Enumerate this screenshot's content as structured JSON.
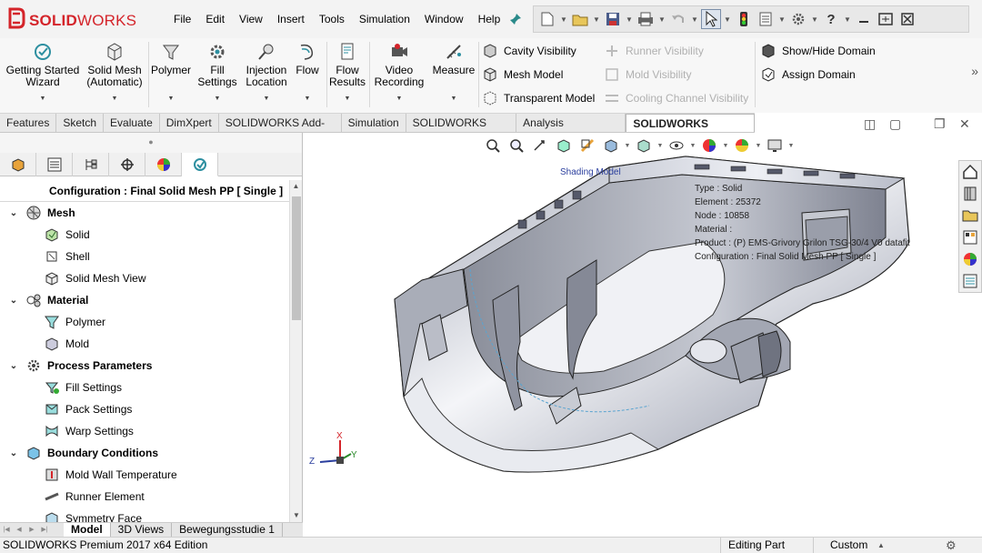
{
  "app": {
    "brand": "SOLIDWORKS",
    "brand_part1": "SOLID",
    "brand_part2": "WORKS",
    "brand_color": "#d4242a"
  },
  "menu": [
    "File",
    "Edit",
    "View",
    "Insert",
    "Tools",
    "Simulation",
    "Window",
    "Help"
  ],
  "ribbon": {
    "buttons": [
      {
        "label1": "Getting Started",
        "label2": "Wizard",
        "icon": "wizard-icon"
      },
      {
        "label1": "Solid Mesh",
        "label2": "(Automatic)",
        "icon": "mesh-cube-icon"
      },
      {
        "label1": "Polymer",
        "label2": "",
        "icon": "polymer-funnel-icon"
      },
      {
        "label1": "Fill",
        "label2": "Settings",
        "icon": "fill-settings-icon"
      },
      {
        "label1": "Injection",
        "label2": "Location",
        "icon": "injection-pin-icon"
      },
      {
        "label1": "Flow",
        "label2": "",
        "icon": "flow-icon"
      },
      {
        "label1": "Flow",
        "label2": "Results",
        "icon": "results-doc-icon"
      },
      {
        "label1": "Video",
        "label2": "Recording",
        "icon": "video-icon"
      },
      {
        "label1": "Measure",
        "label2": "",
        "icon": "measure-icon"
      }
    ],
    "col1": [
      "Cavity Visibility",
      "Mesh Model",
      "Transparent Model"
    ],
    "col2": [
      "Runner Visibility",
      "Mold Visibility",
      "Cooling Channel Visibility"
    ],
    "col3": [
      "Show/Hide Domain",
      "Assign Domain"
    ]
  },
  "tabs": [
    "Features",
    "Sketch",
    "Evaluate",
    "DimXpert",
    "SOLIDWORKS Add-Ins",
    "Simulation",
    "SOLIDWORKS MBD",
    "Analysis Preparation",
    "SOLIDWORKS Plastics"
  ],
  "active_tab": "SOLIDWORKS Plastics",
  "tree": {
    "config": "Configuration : Final Solid Mesh PP [ Single ]",
    "nodes": [
      {
        "type": "grp",
        "label": "Mesh",
        "icon": "mesh-icon"
      },
      {
        "type": "leaf",
        "label": "Solid",
        "icon": "solid-icon"
      },
      {
        "type": "leaf",
        "label": "Shell",
        "icon": "shell-icon"
      },
      {
        "type": "leaf",
        "label": "Solid Mesh View",
        "icon": "mesh-view-icon"
      },
      {
        "type": "grp",
        "label": "Material",
        "icon": "material-icon"
      },
      {
        "type": "leaf",
        "label": "Polymer",
        "icon": "polymer-icon"
      },
      {
        "type": "leaf",
        "label": "Mold",
        "icon": "mold-icon"
      },
      {
        "type": "grp",
        "label": "Process Parameters",
        "icon": "gear-icon"
      },
      {
        "type": "leaf",
        "label": "Fill Settings",
        "icon": "fill-icon"
      },
      {
        "type": "leaf",
        "label": "Pack Settings",
        "icon": "pack-icon"
      },
      {
        "type": "leaf",
        "label": "Warp Settings",
        "icon": "warp-icon"
      },
      {
        "type": "grp",
        "label": "Boundary Conditions",
        "icon": "boundary-icon"
      },
      {
        "type": "leaf",
        "label": "Mold Wall Temperature",
        "icon": "wall-temp-icon"
      },
      {
        "type": "leaf",
        "label": "Runner Element",
        "icon": "runner-icon"
      },
      {
        "type": "leaf",
        "label": "Symmetry Face",
        "icon": "symmetry-icon"
      }
    ]
  },
  "bottom_tabs": [
    "Model",
    "3D Views",
    "Bewegungsstudie 1"
  ],
  "status": {
    "left": "SOLIDWORKS Premium 2017 x64 Edition",
    "mode": "Editing Part",
    "units": "Custom"
  },
  "viewport": {
    "shading_label": "Shading Model",
    "info": [
      "Type : Solid",
      "Element : 25372",
      "Node : 10858",
      "Material :",
      "Product :     (P) EMS-Grivory Grilon TSG-30/4  V0 datafit",
      "Configuration : Final Solid Mesh PP [ Single ]"
    ],
    "triad": {
      "x": "X",
      "y": "Y",
      "z": "Z"
    }
  },
  "colors": {
    "accent": "#d4242a",
    "tab_active": "#ffffff",
    "panel_bg": "#f7f7f7"
  }
}
